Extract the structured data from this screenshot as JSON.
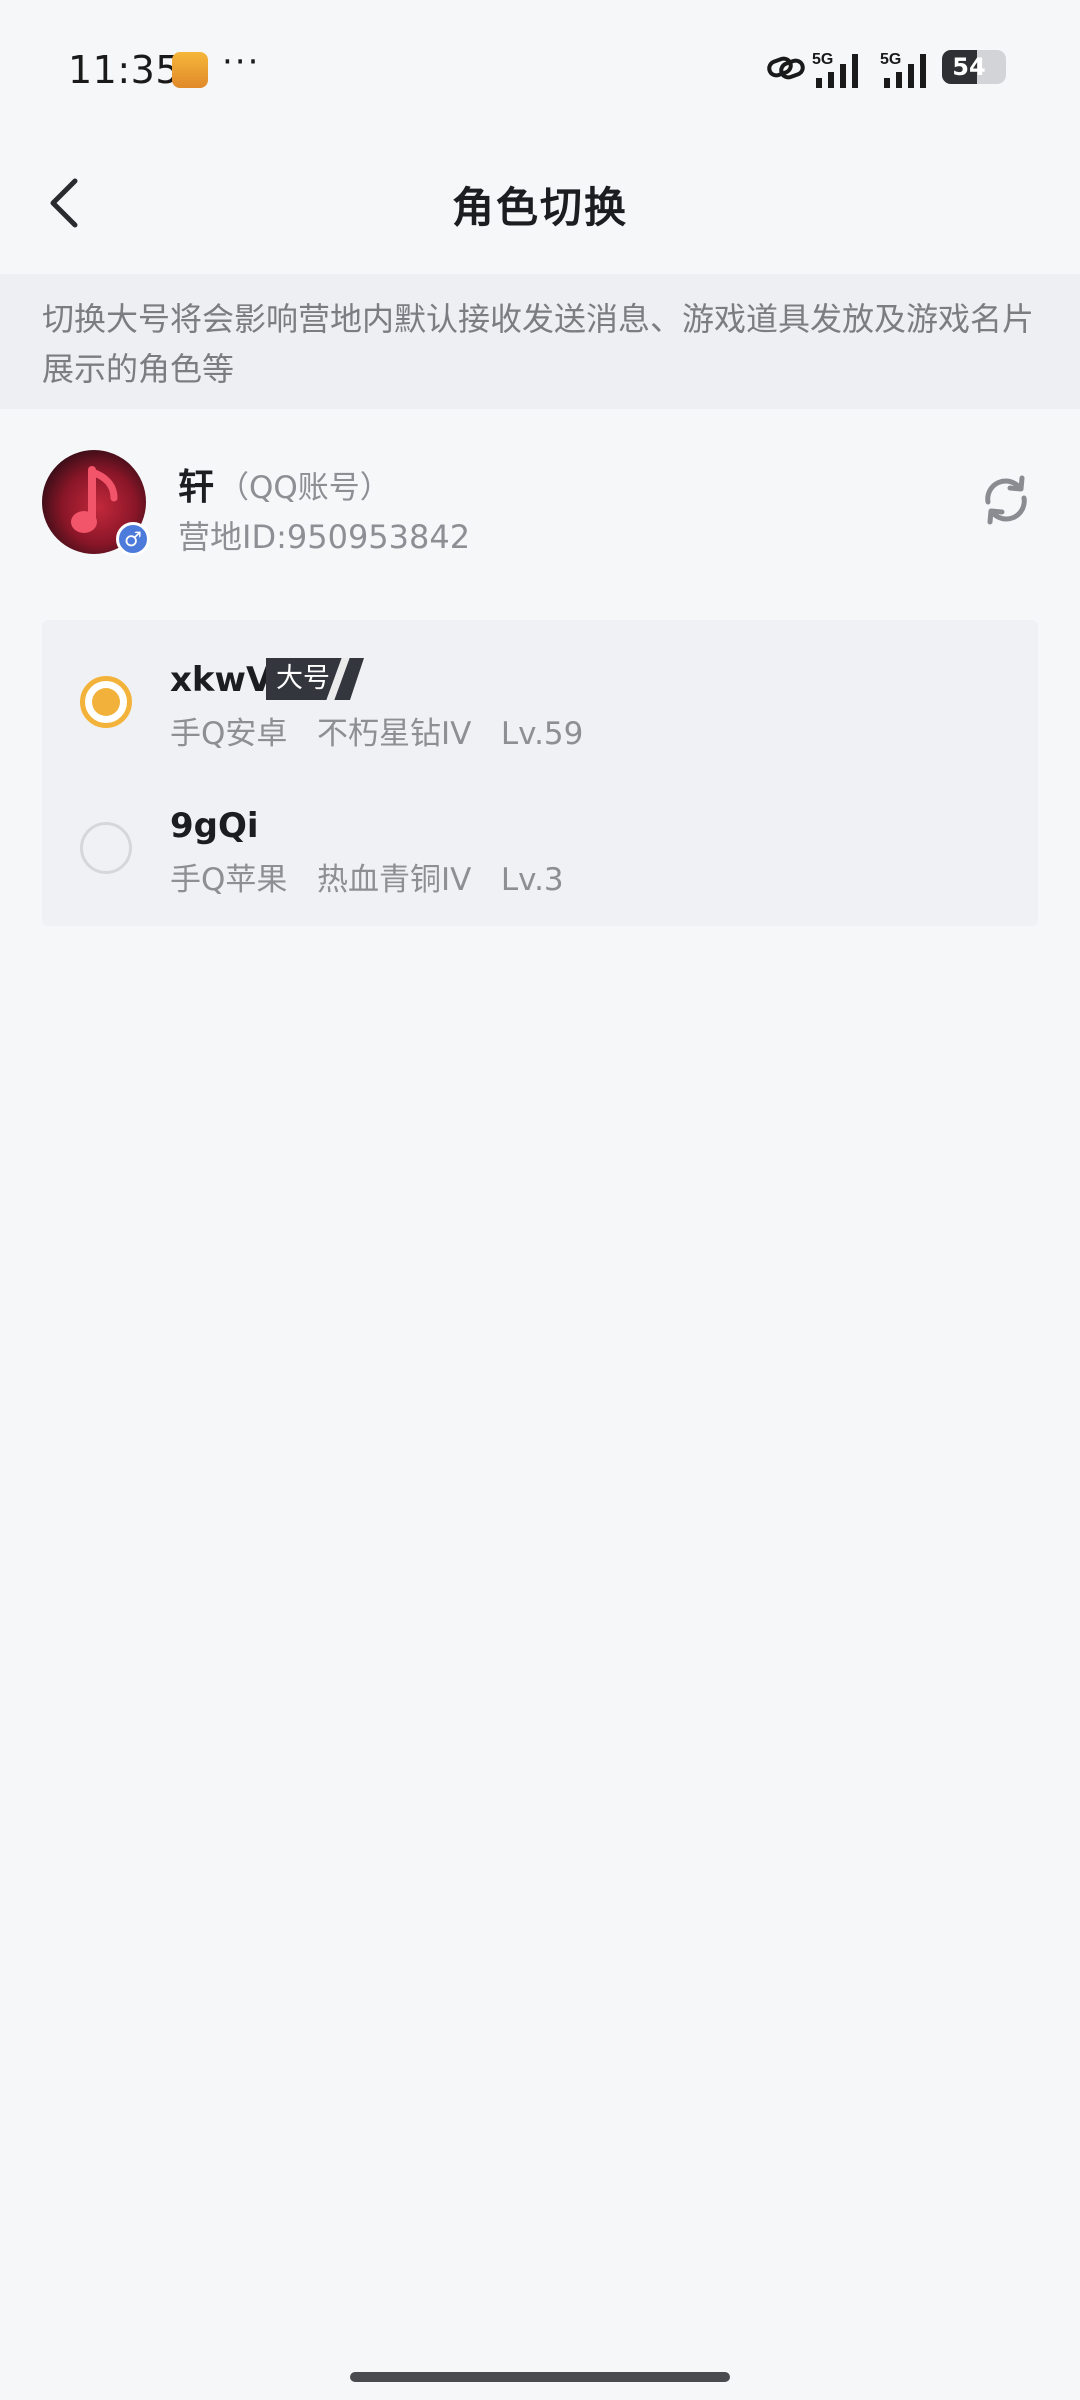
{
  "status_bar": {
    "time": "11:35",
    "dots": "···",
    "network_1": "5G",
    "network_2": "5G",
    "battery": "54"
  },
  "nav": {
    "title": "角色切换",
    "back_icon": "chevron-left-icon"
  },
  "notice": {
    "text": "切换大号将会影响营地内默认接收发送消息、游戏道具发放及游戏名片展示的角色等"
  },
  "profile": {
    "name": "轩",
    "account_type": "（QQ账号）",
    "camp_id": "营地ID:950953842",
    "gender_symbol": "♂",
    "refresh_icon": "refresh-icon"
  },
  "roles": [
    {
      "name": "xkwV",
      "tag": "大号",
      "selected": true,
      "meta": "手Q安卓   不朽星钻IV   Lv.59"
    },
    {
      "name": "9gQi",
      "tag": "",
      "selected": false,
      "meta": "手Q苹果   热血青铜IV   Lv.3"
    }
  ],
  "colors": {
    "accent": "#f2b13b",
    "background": "#f6f7f9",
    "notice_bg": "#eeeff2",
    "card_bg": "#f0f1f4"
  }
}
